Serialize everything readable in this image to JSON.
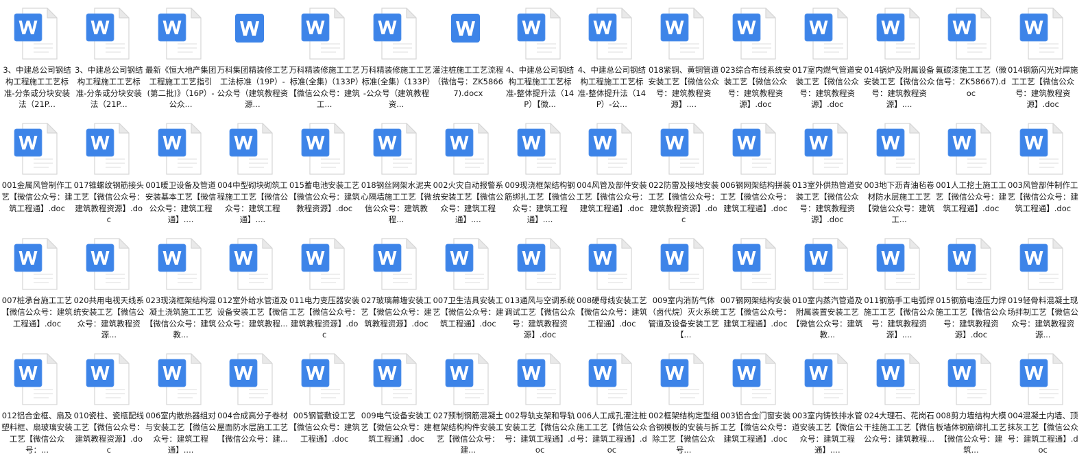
{
  "window": {
    "view": "large-icons"
  },
  "icon_names": {
    "word_doc": "word-document-icon",
    "word_docx": "word-docx-icon"
  },
  "colors": {
    "word_blue": "#3d84e8",
    "word_blue_light": "#5a97ee",
    "page_fill": "#ffffff",
    "page_border": "#d6d6d6",
    "page_fold": "#e9e9e9",
    "text": "#1a1a1a"
  },
  "files": [
    {
      "name": "3、中建总公司钢结构工程施工工艺标准-分条或分块安装法（21P...",
      "type": "doc"
    },
    {
      "name": "3、中建总公司钢结构工程施工工艺标准-分条或分块安装法（21P...",
      "type": "doc"
    },
    {
      "name": "最新《恒大地产集团工程施工工艺指引(第二批)》（16P）-公众...",
      "type": "doc"
    },
    {
      "name": "万科集团精装修工艺工法标准（19P）-公众号（建筑教程资源...",
      "type": "docx"
    },
    {
      "name": "万科精装修施工工艺标准(全集)（133P）【微信公众号：建筑工...",
      "type": "doc"
    },
    {
      "name": "万科精装修施工工艺标准(全集)（133P）-公众号（建筑教程资...",
      "type": "doc"
    },
    {
      "name": "灌注桩施工工艺流程（微信号：ZK58667).docx",
      "type": "docx"
    },
    {
      "name": "4、中建总公司钢结构工程施工工艺标准-整体提升法（14P）【微...",
      "type": "doc"
    },
    {
      "name": "4、中建总公司钢结构工程施工工艺标准-整体提升法（14P）-公...",
      "type": "doc"
    },
    {
      "name": "018紫铜、黄铜管道安装工艺【微信公众号：建筑教程资源】....",
      "type": "doc"
    },
    {
      "name": "023综合布线系统安装工艺【微信公众号：建筑教程资源】.doc",
      "type": "doc"
    },
    {
      "name": "017室内燃气管道安装工艺【微信公众号：建筑教程资源】.doc",
      "type": "doc"
    },
    {
      "name": "014锅炉及附属设备安装工艺【微信公众号：建筑教程资源】....",
      "type": "doc"
    },
    {
      "name": "氟碳漆施工工艺（微信号：ZK58667).doc",
      "type": "doc"
    },
    {
      "name": "014钢筋闪光对焊施工工艺【微信公众号：建筑教程资源】.doc",
      "type": "doc"
    },
    {
      "name": "001金属风管制作工艺【微信公众号：建筑工程通】.doc",
      "type": "doc"
    },
    {
      "name": "017锥螺纹钢筋接头工艺【微信公众号：建筑教程资源】.doc",
      "type": "doc"
    },
    {
      "name": "001暖卫设备及管道安装基本工艺【微信公众号：建筑工程通】....",
      "type": "doc"
    },
    {
      "name": "004中型砌块砌筑工程施工工艺【微信公众号：建筑工程通】....",
      "type": "doc"
    },
    {
      "name": "015蓄电池安装工艺【微信公众号：建筑教程资源】.doc",
      "type": "doc"
    },
    {
      "name": "018钢丝网架水泥夹心隔墙施工工艺【微信公众号：建筑教程...",
      "type": "doc"
    },
    {
      "name": "002火灾自动报警系统安装工艺【微信公众号：建筑工程通】....",
      "type": "doc"
    },
    {
      "name": "009现浇框架结构钢筋绑扎工艺【微信公众号：建筑工程通】....",
      "type": "doc"
    },
    {
      "name": "004风管及部件安装工艺【微信公众号：建筑工程通】.doc",
      "type": "doc"
    },
    {
      "name": "022防雷及接地安装工艺【微信公众号：建筑教程资源】.doc",
      "type": "doc"
    },
    {
      "name": "006钢网架结构拼装工艺【微信公众号：建筑工程通】.doc",
      "type": "doc"
    },
    {
      "name": "013室外供热管道安装工艺【微信公众号：建筑教程资源】.doc",
      "type": "doc"
    },
    {
      "name": "003地下沥青油毡卷材防水层施工工艺【微信公众号：建筑工...",
      "type": "doc"
    },
    {
      "name": "001人工挖土施工工艺【微信公众号：建筑工程通】.doc",
      "type": "doc"
    },
    {
      "name": "003风管部件制作工艺【微信公众号：建筑工程通】.doc",
      "type": "doc"
    },
    {
      "name": "007桩承台施工工艺【微信公众号：建筑工程通】.doc",
      "type": "doc"
    },
    {
      "name": "020共用电视天线系统安装工艺【微信公众号：建筑教程资源...",
      "type": "doc"
    },
    {
      "name": "023现浇框架结构混凝土浇筑施工工艺【微信公众号：建筑教...",
      "type": "doc"
    },
    {
      "name": "012室外给水管道及设备安装工艺【微信公众号：建筑教程...",
      "type": "doc"
    },
    {
      "name": "011电力变压器安装工艺【微信公众号：建筑教程资源】.doc",
      "type": "doc"
    },
    {
      "name": "027玻璃幕墙安装工艺【微信公众号：建筑教程资源】.doc",
      "type": "doc"
    },
    {
      "name": "007卫生洁具安装工艺【微信公众号：建筑工程通】.doc",
      "type": "doc"
    },
    {
      "name": "013通风与空调系统调试工艺【微信公众号：建筑教程资源】.doc",
      "type": "doc"
    },
    {
      "name": "008硬母线安装工艺【微信公众号：建筑工程通】.doc",
      "type": "doc"
    },
    {
      "name": "009室内消防气体（卤代烷）灭火系统管道及设备安装工艺【...",
      "type": "doc"
    },
    {
      "name": "007钢网架结构安装工艺【微信公众号：建筑工程通】.doc",
      "type": "doc"
    },
    {
      "name": "010室内蒸汽管道及附属装置安装工艺【微信公众号：建筑教...",
      "type": "doc"
    },
    {
      "name": "011钢筋手工电弧焊施工工艺【微信公众号：建筑教程资源】....",
      "type": "doc"
    },
    {
      "name": "015钢筋电渣压力焊施工工艺【微信公众号：建筑教程资源】.doc",
      "type": "doc"
    },
    {
      "name": "019轻骨料混凝土现场拌制工艺【微信公众号：建筑教程资源...",
      "type": "doc"
    },
    {
      "name": "012铝合金框、扇及塑料框、扇玻璃安装工艺【微信公众号：...",
      "type": "doc"
    },
    {
      "name": "010瓷柱、瓷瓶配线工艺【微信公众号：建筑教程资源】.doc",
      "type": "doc"
    },
    {
      "name": "006室内散热器组对与安装工艺【微信公众号：建筑工程通】....",
      "type": "doc"
    },
    {
      "name": "004合成高分子卷材屋面防水层施工工艺【微信公众号：建...",
      "type": "doc"
    },
    {
      "name": "005钢管敷设工艺【微信公众号：建筑工程通】.doc",
      "type": "doc"
    },
    {
      "name": "009电气设备安装工艺【微信公众号：建筑工程通】.doc",
      "type": "doc"
    },
    {
      "name": "027预制钢筋混凝土框架结构构件安装工艺【微信公众号：建...",
      "type": "doc"
    },
    {
      "name": "002导轨支架和导轨安装工艺【微信公众号：建筑工程通】.doc",
      "type": "doc"
    },
    {
      "name": "006人工成孔灌注桩施工工艺【微信公众号：建筑工程通】.doc",
      "type": "doc"
    },
    {
      "name": "002框架结构定型组合钢模板的安装与拆除工艺【微信公众号...",
      "type": "doc"
    },
    {
      "name": "003铝合金门窗安装工艺【微信公众号：建筑工程通】.doc",
      "type": "doc"
    },
    {
      "name": "003室内铸铁排水管道安装工艺【微信公众号：建筑工程通】....",
      "type": "doc"
    },
    {
      "name": "024大理石、花岗石干挂施工工艺【微信公众号：建筑教程...",
      "type": "doc"
    },
    {
      "name": "008剪力墙结构大模板墙体钢筋绑扎工艺【微信公众号：建筑...",
      "type": "doc"
    },
    {
      "name": "004混凝土内墙、顶抹灰工艺【微信公众号：建筑工程通】.doc",
      "type": "doc"
    }
  ]
}
